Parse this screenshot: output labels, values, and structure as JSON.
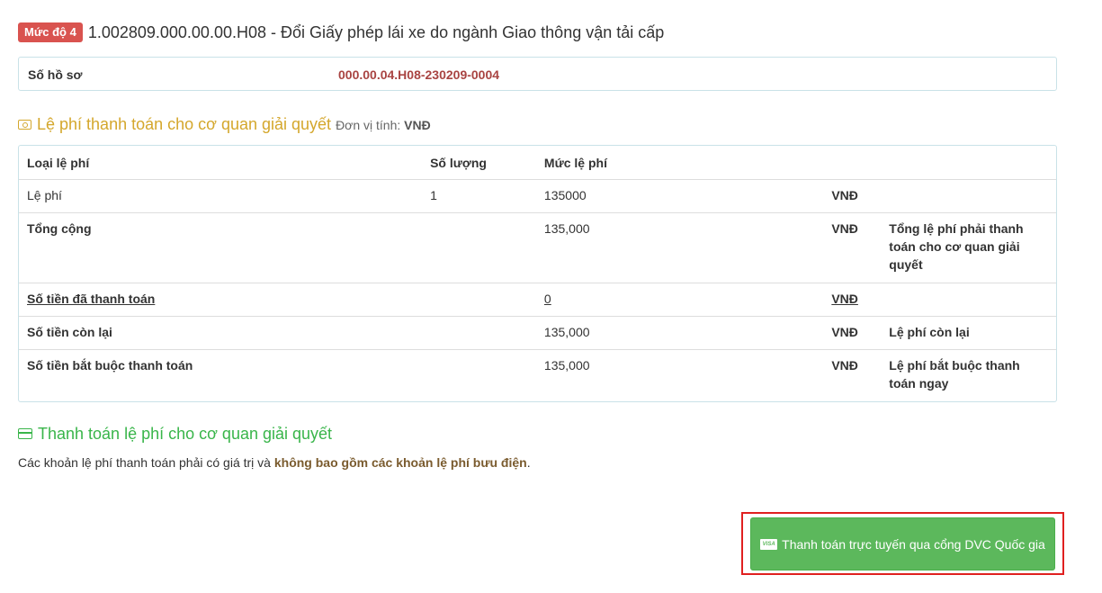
{
  "header": {
    "level_badge": "Mức độ 4",
    "title": "1.002809.000.00.00.H08 - Đổi Giấy phép lái xe do ngành Giao thông vận tải cấp"
  },
  "file_info": {
    "label": "Số hồ sơ",
    "value": "000.00.04.H08-230209-0004"
  },
  "fee_section": {
    "icon": "money-icon",
    "title": "Lệ phí thanh toán cho cơ quan giải quyết",
    "unit_prefix": "Đơn vị tính:",
    "unit": "VNĐ",
    "columns": [
      "Loại lệ phí",
      "Số lượng",
      "Mức lệ phí"
    ],
    "rows": [
      {
        "name": "Lệ phí",
        "qty": "1",
        "amount": "135000",
        "currency": "VNĐ",
        "note": ""
      },
      {
        "name": "Tổng cộng",
        "qty": "",
        "amount": "135,000",
        "currency": "VNĐ",
        "note": "Tổng lệ phí phải thanh toán cho cơ quan giải quyết"
      },
      {
        "name": "Số tiền đã thanh toán",
        "qty": "",
        "amount": "0",
        "currency": "VNĐ",
        "note": ""
      },
      {
        "name": "Số tiền còn lại",
        "qty": "",
        "amount": "135,000",
        "currency": "VNĐ",
        "note": "Lệ phí còn lại"
      },
      {
        "name": "Số tiền bắt buộc thanh toán",
        "qty": "",
        "amount": "135,000",
        "currency": "VNĐ",
        "note": "Lệ phí bắt buộc thanh toán ngay"
      }
    ]
  },
  "payment_section": {
    "icon": "credit-card-icon",
    "title": "Thanh toán lệ phí cho cơ quan giải quyết",
    "note_prefix": "Các khoản lệ phí thanh toán phải có giá trị và",
    "note_bold": "không bao gồm các khoản lệ phí bưu điện",
    "note_suffix": ".",
    "button_icon_text": "VISA",
    "button_label": "Thanh toán trực tuyến qua cổng DVC Quốc gia"
  },
  "colors": {
    "badge": "#d9534f",
    "fee_title": "#d4a72c",
    "payment_title": "#39b54a",
    "button": "#5cb85c",
    "highlight_border": "#e02020",
    "file_value": "#a94442"
  }
}
